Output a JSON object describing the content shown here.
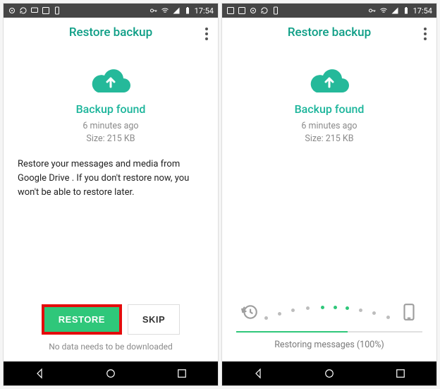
{
  "statusbar": {
    "time": "17:54"
  },
  "appbar": {
    "title": "Restore backup"
  },
  "backup": {
    "found_label": "Backup found",
    "time_ago": "6 minutes ago",
    "size_label": "Size: 215 KB"
  },
  "left": {
    "description": "Restore your messages and media from Google Drive . If you don't restore now, you won't be able to restore later.",
    "restore_btn": "RESTORE",
    "skip_btn": "SKIP",
    "footnote": "No data needs to be downloaded"
  },
  "right": {
    "status": "Restoring messages (100%)",
    "progress_percent": 100
  },
  "colors": {
    "accent": "#2fc77a",
    "teal": "#0e9e86",
    "highlight": "#e40c0c"
  }
}
